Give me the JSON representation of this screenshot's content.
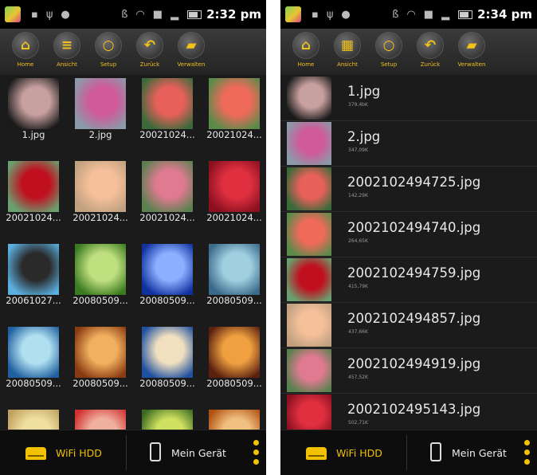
{
  "phones": [
    {
      "time": "2:32 pm",
      "toolbar": [
        {
          "label": "Home",
          "icon": "home-icon",
          "glyph": "⌂"
        },
        {
          "label": "Ansicht",
          "icon": "list-view-icon",
          "glyph": "≡"
        },
        {
          "label": "Setup",
          "icon": "setup-icon",
          "glyph": "○"
        },
        {
          "label": "Zurück",
          "icon": "back-icon",
          "glyph": "↶"
        },
        {
          "label": "Verwalten",
          "icon": "folder-icon",
          "glyph": "▰"
        }
      ],
      "files": [
        {
          "name": "1.jpg",
          "colors": [
            "#1a1a1a",
            "#c9a0a0"
          ]
        },
        {
          "name": "2.jpg",
          "colors": [
            "#8a9aa8",
            "#d05a9a"
          ]
        },
        {
          "name": "20021024...",
          "colors": [
            "#3a6a3a",
            "#e8605a"
          ]
        },
        {
          "name": "20021024...",
          "colors": [
            "#5a8a4a",
            "#f06a5a"
          ]
        },
        {
          "name": "20021024...",
          "colors": [
            "#6aa070",
            "#c01020"
          ]
        },
        {
          "name": "20021024...",
          "colors": [
            "#c0a080",
            "#f5c09a"
          ]
        },
        {
          "name": "20021024...",
          "colors": [
            "#5a8050",
            "#e07a90"
          ]
        },
        {
          "name": "20021024...",
          "colors": [
            "#8a1020",
            "#e03040"
          ]
        },
        {
          "name": "20061027...",
          "colors": [
            "#5ab0e0",
            "#2a2a2a"
          ]
        },
        {
          "name": "20080509...",
          "colors": [
            "#3a7a20",
            "#c0e080"
          ]
        },
        {
          "name": "20080509...",
          "colors": [
            "#1030a0",
            "#8ab0ff"
          ]
        },
        {
          "name": "20080509...",
          "colors": [
            "#3a6a8a",
            "#a0d0e0"
          ]
        },
        {
          "name": "20080509...",
          "colors": [
            "#2060a0",
            "#b0e0f0"
          ]
        },
        {
          "name": "20080509...",
          "colors": [
            "#8a3a10",
            "#f0b060"
          ]
        },
        {
          "name": "20080509...",
          "colors": [
            "#2050a0",
            "#f0e0c0"
          ]
        },
        {
          "name": "20080509...",
          "colors": [
            "#5a2010",
            "#f0a040"
          ]
        },
        {
          "name": "",
          "colors": [
            "#c0a060",
            "#f0e0a0"
          ]
        },
        {
          "name": "",
          "colors": [
            "#d03030",
            "#f0b0a0"
          ]
        },
        {
          "name": "",
          "colors": [
            "#3a6a20",
            "#d0e060"
          ]
        },
        {
          "name": "",
          "colors": [
            "#b05010",
            "#f0c080"
          ]
        }
      ],
      "bottom": {
        "wifi_label": "WiFi HDD",
        "device_label": "Mein Gerät"
      }
    },
    {
      "time": "2:34 pm",
      "toolbar": [
        {
          "label": "Home",
          "icon": "home-icon",
          "glyph": "⌂"
        },
        {
          "label": "Ansicht",
          "icon": "grid-view-icon",
          "glyph": "▦"
        },
        {
          "label": "Setup",
          "icon": "setup-icon",
          "glyph": "○"
        },
        {
          "label": "Zurück",
          "icon": "back-icon",
          "glyph": "↶"
        },
        {
          "label": "Verwalten",
          "icon": "folder-icon",
          "glyph": "▰"
        }
      ],
      "files": [
        {
          "name": "1.jpg",
          "size": "379,4bK",
          "colors": [
            "#1a1a1a",
            "#c9a0a0"
          ]
        },
        {
          "name": "2.jpg",
          "size": "347,09K",
          "colors": [
            "#8a9aa8",
            "#d05a9a"
          ]
        },
        {
          "name": "2002102494725.jpg",
          "size": "142,29K",
          "colors": [
            "#3a6a3a",
            "#e8605a"
          ]
        },
        {
          "name": "2002102494740.jpg",
          "size": "264,65K",
          "colors": [
            "#5a8a4a",
            "#f06a5a"
          ]
        },
        {
          "name": "2002102494759.jpg",
          "size": "415,79K",
          "colors": [
            "#6aa070",
            "#c01020"
          ]
        },
        {
          "name": "2002102494857.jpg",
          "size": "437,66K",
          "colors": [
            "#c0a080",
            "#f5c09a"
          ]
        },
        {
          "name": "2002102494919.jpg",
          "size": "457,52K",
          "colors": [
            "#5a8050",
            "#e07a90"
          ]
        },
        {
          "name": "2002102495143.jpg",
          "size": "502,71K",
          "colors": [
            "#8a1020",
            "#e03040"
          ]
        }
      ],
      "bottom": {
        "wifi_label": "WiFi HDD",
        "device_label": "Mein Gerät"
      }
    }
  ]
}
